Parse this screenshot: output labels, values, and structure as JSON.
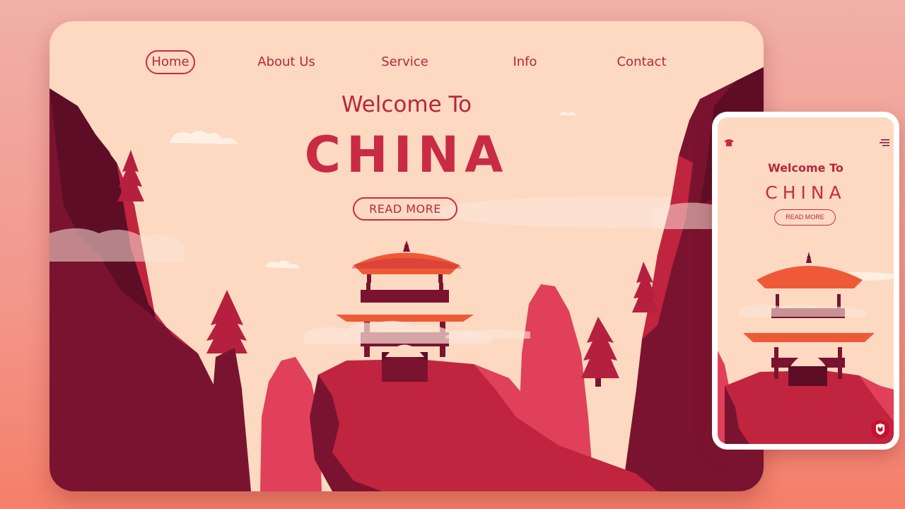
{
  "desktop": {
    "nav": {
      "items": [
        {
          "label": "Home",
          "active": true
        },
        {
          "label": "About Us",
          "active": false
        },
        {
          "label": "Service",
          "active": false
        },
        {
          "label": "Info",
          "active": false
        },
        {
          "label": "Contact",
          "active": false
        }
      ]
    },
    "hero": {
      "welcome": "Welcome To",
      "title": "CHINA",
      "cta": "READ MORE"
    }
  },
  "mobile": {
    "icons": {
      "home": "pagoda-home-icon",
      "menu": "hamburger-menu-icon",
      "badge": "shield-badge-icon"
    },
    "hero": {
      "welcome": "Welcome To",
      "title": "CHINA",
      "cta": "READ MORE"
    }
  },
  "colors": {
    "sky": "#fdd9c2",
    "accent": "#c92b44",
    "dark_cliff": "#7a1330",
    "mid_cliff": "#b5203f",
    "light_rock": "#e0405a",
    "roof": "#ee5a38"
  }
}
